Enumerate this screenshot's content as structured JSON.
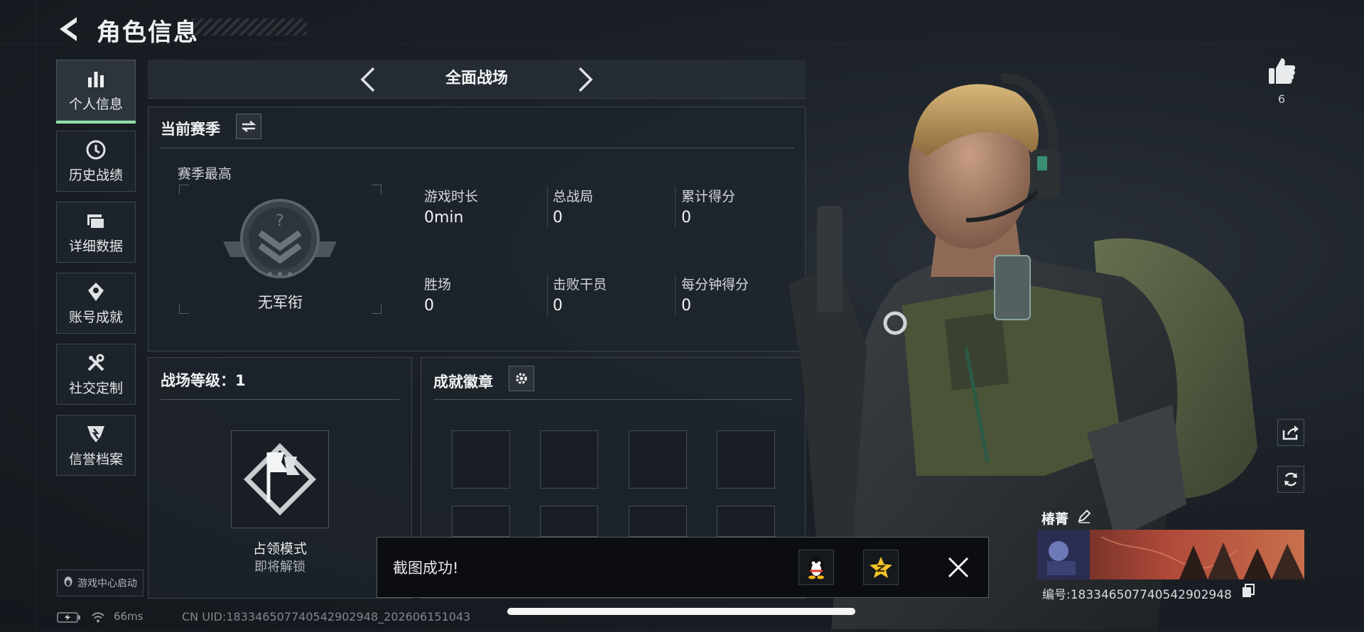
{
  "header": {
    "title": "角色信息"
  },
  "sidebar": {
    "items": [
      {
        "label": "个人信息",
        "icon": "bar-chart-icon"
      },
      {
        "label": "历史战绩",
        "icon": "history-clock-icon"
      },
      {
        "label": "详细数据",
        "icon": "folder-icon"
      },
      {
        "label": "账号成就",
        "icon": "achievement-icon"
      },
      {
        "label": "社交定制",
        "icon": "tools-icon"
      },
      {
        "label": "信誉档案",
        "icon": "credit-shield-icon"
      }
    ],
    "active_index": 0,
    "game_center": "游戏中心启动"
  },
  "mode": {
    "title": "全面战场"
  },
  "season": {
    "title": "当前赛季",
    "best_label": "赛季最高",
    "rank_name": "无军衔",
    "stats": [
      {
        "label": "游戏时长",
        "value": "0min"
      },
      {
        "label": "总战局",
        "value": "0"
      },
      {
        "label": "累计得分",
        "value": "0"
      },
      {
        "label": "胜场",
        "value": "0"
      },
      {
        "label": "击败干员",
        "value": "0"
      },
      {
        "label": "每分钟得分",
        "value": "0"
      }
    ]
  },
  "battle_level": {
    "title": "战场等级：1",
    "mode_name": "占领模式",
    "mode_status": "即将解锁"
  },
  "badges": {
    "title": "成就徽章"
  },
  "toast": {
    "text": "截图成功!"
  },
  "likes": {
    "count": "6"
  },
  "player": {
    "name": "椿菁",
    "id_text": "编号:1833465077405429029​48"
  },
  "status": {
    "ping": "66ms",
    "uid": "CN UID:18334650774054290294​8_202606151043"
  },
  "colors": {
    "accent_green": "#8de0a6",
    "panel_border": "#3a424b"
  }
}
